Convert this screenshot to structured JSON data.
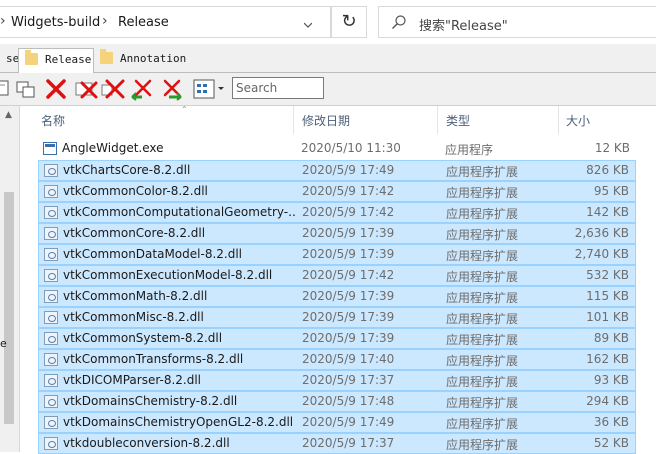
{
  "address": {
    "crumbs": [
      "Widgets-build",
      "Release"
    ],
    "search_placeholder": "搜索\"Release\""
  },
  "tabs": [
    {
      "label": "se",
      "active": false
    },
    {
      "label": "Release",
      "active": true
    },
    {
      "label": "Annotation",
      "active": false
    }
  ],
  "toolbar": {
    "search_placeholder": "Search",
    "icons": [
      "copy-icon",
      "delete-icon",
      "delete-icon",
      "delete-icon",
      "undo-icon",
      "redo-icon",
      "view-mode-icon"
    ]
  },
  "left_pane": {
    "label": "e"
  },
  "columns": {
    "name": "名称",
    "date": "修改日期",
    "type": "类型",
    "size": "大小"
  },
  "files": [
    {
      "name": "AngleWidget.exe",
      "date": "2020/5/10 11:30",
      "type": "应用程序",
      "size": "12 KB",
      "selected": false,
      "icon": "exe-icon"
    },
    {
      "name": "vtkChartsCore-8.2.dll",
      "date": "2020/5/9 17:49",
      "type": "应用程序扩展",
      "size": "826 KB",
      "selected": true,
      "icon": "dll-icon"
    },
    {
      "name": "vtkCommonColor-8.2.dll",
      "date": "2020/5/9 17:42",
      "type": "应用程序扩展",
      "size": "95 KB",
      "selected": true,
      "icon": "dll-icon"
    },
    {
      "name": "vtkCommonComputationalGeometry-...",
      "date": "2020/5/9 17:42",
      "type": "应用程序扩展",
      "size": "142 KB",
      "selected": true,
      "icon": "dll-icon"
    },
    {
      "name": "vtkCommonCore-8.2.dll",
      "date": "2020/5/9 17:39",
      "type": "应用程序扩展",
      "size": "2,636 KB",
      "selected": true,
      "icon": "dll-icon"
    },
    {
      "name": "vtkCommonDataModel-8.2.dll",
      "date": "2020/5/9 17:39",
      "type": "应用程序扩展",
      "size": "2,740 KB",
      "selected": true,
      "icon": "dll-icon"
    },
    {
      "name": "vtkCommonExecutionModel-8.2.dll",
      "date": "2020/5/9 17:42",
      "type": "应用程序扩展",
      "size": "532 KB",
      "selected": true,
      "icon": "dll-icon"
    },
    {
      "name": "vtkCommonMath-8.2.dll",
      "date": "2020/5/9 17:39",
      "type": "应用程序扩展",
      "size": "115 KB",
      "selected": true,
      "icon": "dll-icon"
    },
    {
      "name": "vtkCommonMisc-8.2.dll",
      "date": "2020/5/9 17:39",
      "type": "应用程序扩展",
      "size": "101 KB",
      "selected": true,
      "icon": "dll-icon"
    },
    {
      "name": "vtkCommonSystem-8.2.dll",
      "date": "2020/5/9 17:39",
      "type": "应用程序扩展",
      "size": "89 KB",
      "selected": true,
      "icon": "dll-icon"
    },
    {
      "name": "vtkCommonTransforms-8.2.dll",
      "date": "2020/5/9 17:40",
      "type": "应用程序扩展",
      "size": "162 KB",
      "selected": true,
      "icon": "dll-icon"
    },
    {
      "name": "vtkDICOMParser-8.2.dll",
      "date": "2020/5/9 17:37",
      "type": "应用程序扩展",
      "size": "93 KB",
      "selected": true,
      "icon": "dll-icon"
    },
    {
      "name": "vtkDomainsChemistry-8.2.dll",
      "date": "2020/5/9 17:48",
      "type": "应用程序扩展",
      "size": "294 KB",
      "selected": true,
      "icon": "dll-icon"
    },
    {
      "name": "vtkDomainsChemistryOpenGL2-8.2.dll",
      "date": "2020/5/9 17:49",
      "type": "应用程序扩展",
      "size": "36 KB",
      "selected": true,
      "icon": "dll-icon"
    },
    {
      "name": "vtkdoubleconversion-8.2.dll",
      "date": "2020/5/9 17:37",
      "type": "应用程序扩展",
      "size": "52 KB",
      "selected": true,
      "icon": "dll-icon"
    }
  ]
}
